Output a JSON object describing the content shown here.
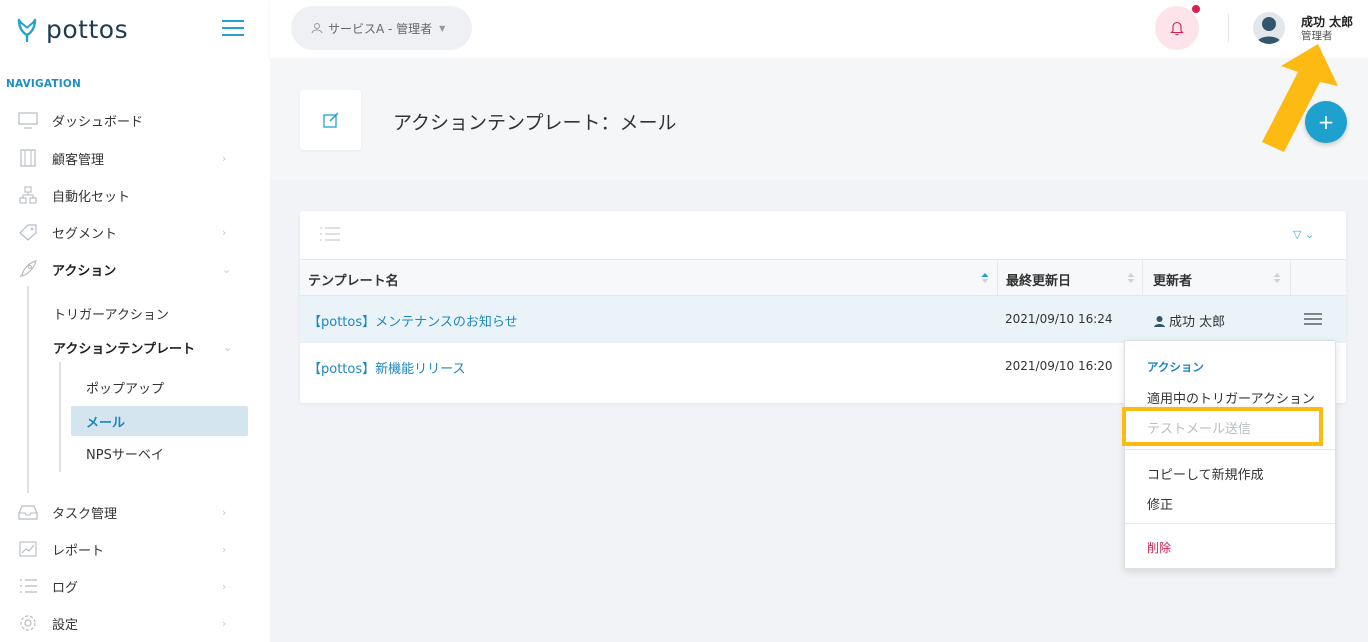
{
  "app": {
    "name": "pottos"
  },
  "sidebar": {
    "nav_heading": "NAVIGATION",
    "items": [
      {
        "label": "ダッシュボード",
        "icon": "monitor-icon"
      },
      {
        "label": "顧客管理",
        "icon": "building-icon"
      },
      {
        "label": "自動化セット",
        "icon": "sitemap-icon"
      },
      {
        "label": "セグメント",
        "icon": "tag-icon"
      },
      {
        "label": "アクション",
        "icon": "rocket-icon"
      },
      {
        "label": "タスク管理",
        "icon": "inbox-icon"
      },
      {
        "label": "レポート",
        "icon": "chart-icon"
      },
      {
        "label": "ログ",
        "icon": "list-icon"
      },
      {
        "label": "設定",
        "icon": "gear-icon"
      }
    ],
    "action_sub": {
      "trigger": "トリガーアクション",
      "template": "アクションテンプレート",
      "template_sub": {
        "popup": "ポップアップ",
        "mail": "メール",
        "nps": "NPSサーベイ"
      }
    }
  },
  "topbar": {
    "service": "サービスA - 管理者",
    "user_name": "成功 太郎",
    "user_role": "管理者"
  },
  "page": {
    "title": "アクションテンプレート：メール",
    "add_label": "+"
  },
  "table": {
    "columns": [
      "テンプレート名",
      "最終更新日",
      "更新者"
    ],
    "rows": [
      {
        "name": "【pottos】メンテナンスのお知らせ",
        "date": "2021/09/10 16:24",
        "user": "成功 太郎"
      },
      {
        "name": "【pottos】新機能リリース",
        "date": "2021/09/10 16:20",
        "user": ""
      }
    ]
  },
  "dropdown": {
    "heading": "アクション",
    "items": [
      "適用中のトリガーアクション",
      "テストメール送信",
      "コピーして新規作成",
      "修正",
      "削除"
    ]
  },
  "colors": {
    "accent": "#1ea1cf",
    "link": "#1c87bf",
    "danger": "#d6204e",
    "highlight": "#fdba12",
    "selected_row": "#eaf3f8"
  }
}
